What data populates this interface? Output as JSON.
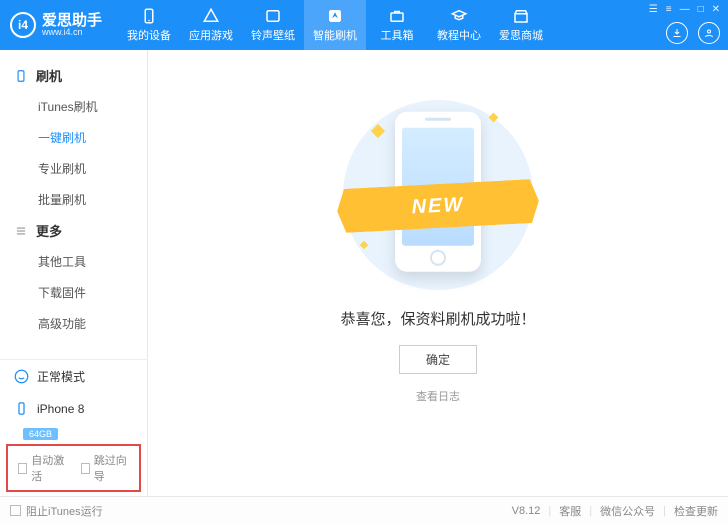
{
  "brand": {
    "logo_text": "i4",
    "name": "爱思助手",
    "url": "www.i4.cn"
  },
  "tabs": [
    {
      "label": "我的设备"
    },
    {
      "label": "应用游戏"
    },
    {
      "label": "铃声壁纸"
    },
    {
      "label": "智能刷机",
      "active": true
    },
    {
      "label": "工具箱"
    },
    {
      "label": "教程中心"
    },
    {
      "label": "爱思商城"
    }
  ],
  "sidebar": {
    "group1": {
      "title": "刷机",
      "items": [
        "iTunes刷机",
        "一键刷机",
        "专业刷机",
        "批量刷机"
      ],
      "active_index": 1
    },
    "group2": {
      "title": "更多",
      "items": [
        "其他工具",
        "下载固件",
        "高级功能"
      ]
    }
  },
  "device": {
    "mode": "正常模式",
    "model": "iPhone 8",
    "storage": "64GB"
  },
  "options": {
    "auto_activate": "自动激活",
    "skip_guide": "跳过向导"
  },
  "main": {
    "ribbon": "NEW",
    "message": "恭喜您，保资料刷机成功啦！",
    "ok": "确定",
    "view_log": "查看日志"
  },
  "footer": {
    "block_itunes": "阻止iTunes运行",
    "version": "V8.12",
    "support": "客服",
    "wechat": "微信公众号",
    "update": "检查更新"
  }
}
